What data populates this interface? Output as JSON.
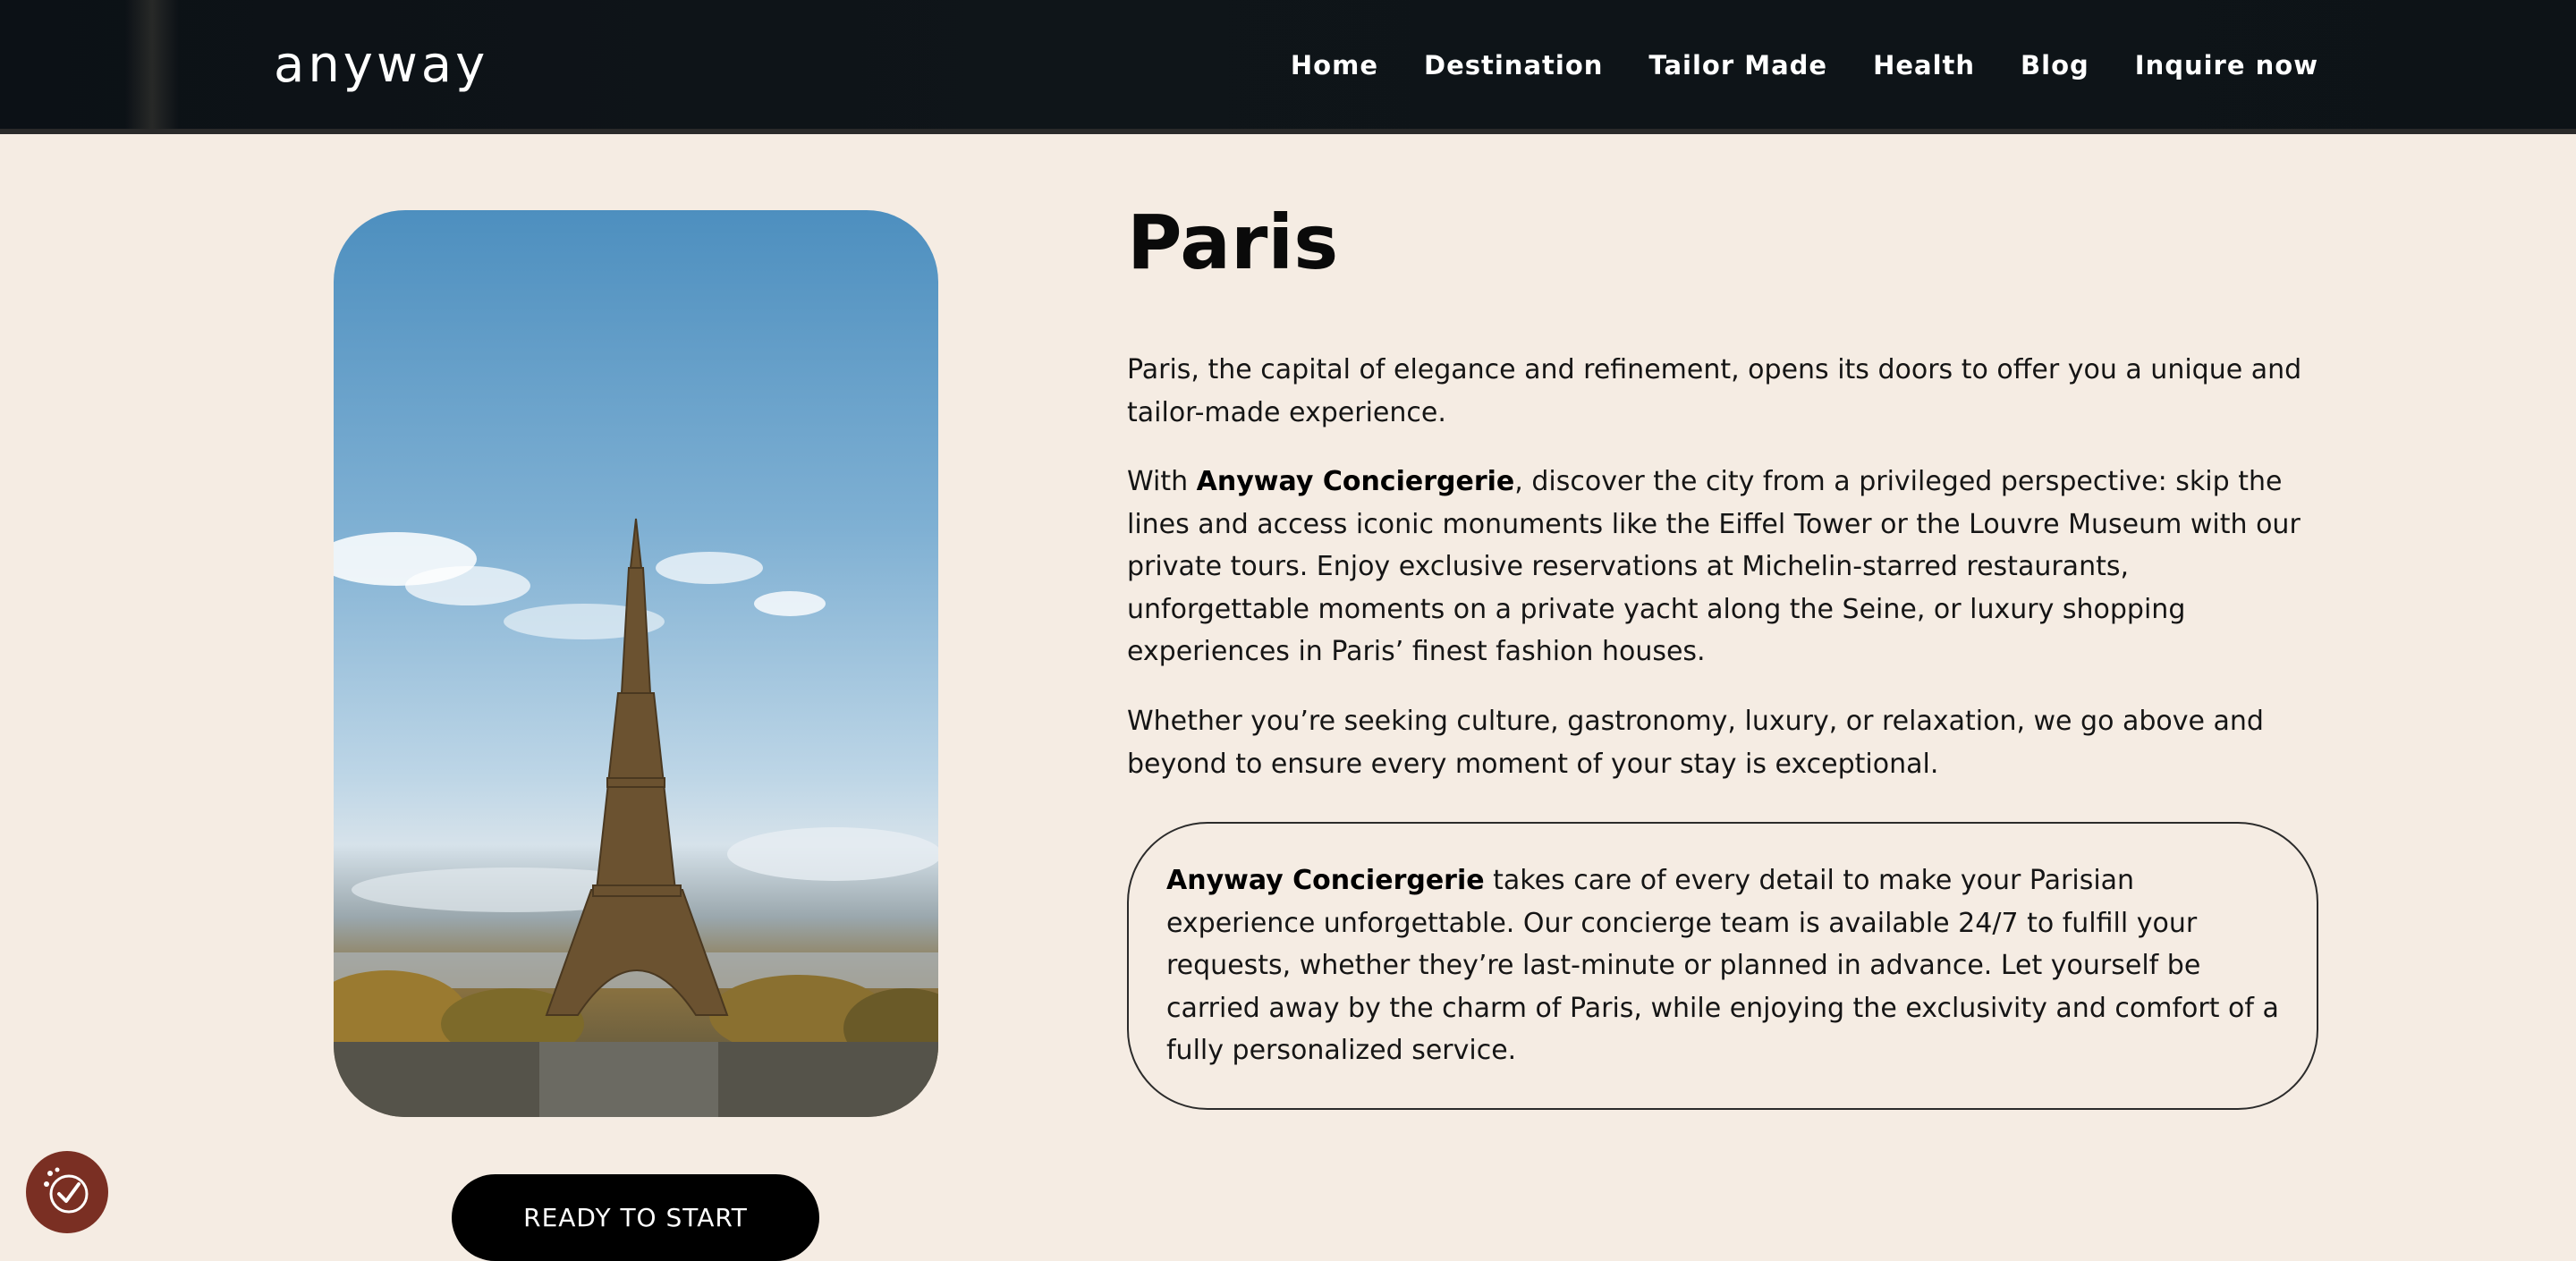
{
  "header": {
    "logo": "anyway",
    "nav": [
      {
        "label": "Home"
      },
      {
        "label": "Destination"
      },
      {
        "label": "Tailor Made"
      },
      {
        "label": "Health"
      },
      {
        "label": "Blog"
      },
      {
        "label": "Inquire now"
      }
    ]
  },
  "main": {
    "title": "Paris",
    "paragraph1": "Paris, the capital of elegance and refinement, opens its doors to offer you a unique and tailor-made experience.",
    "paragraph2": {
      "prefix": "With ",
      "bold": "Anyway Conciergerie",
      "rest": ", discover the city from a privileged perspective: skip the lines and access iconic monuments like the Eiffel Tower or the Louvre Museum with our private tours. Enjoy exclusive reservations at Michelin-starred restaurants, unforgettable moments on a private yacht along the Seine, or luxury shopping experiences in Paris’ finest fashion houses."
    },
    "paragraph3": "Whether you’re seeking culture, gastronomy, luxury, or relaxation, we go above and beyond to ensure every moment of your stay is exceptional.",
    "highlight": {
      "bold": "Anyway Conciergerie",
      "rest": " takes care of every detail to make your Parisian experience unforgettable. Our concierge team is available 24/7 to fulfill your requests, whether they’re last-minute or planned in advance. Let yourself be carried away by the charm of Paris, while enjoying the exclusivity and comfort of a fully personalized service."
    },
    "cta_label": "READY TO START"
  },
  "icons": {
    "photo": "eiffel-tower-photo",
    "badge": "consent-check-icon"
  },
  "colors": {
    "header_bg": "#0f1519",
    "page_bg": "#f5ece3",
    "cta_bg": "#000000",
    "badge_bg": "#7a2f23"
  }
}
